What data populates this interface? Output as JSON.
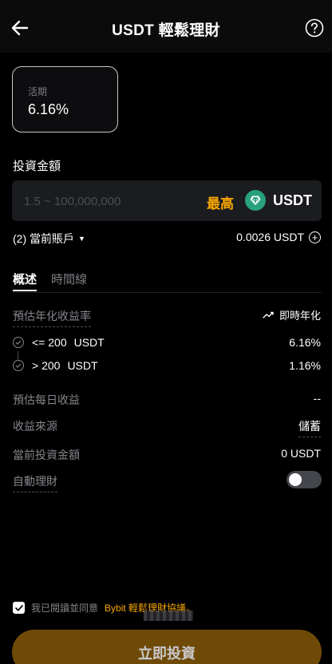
{
  "header": {
    "title": "USDT 輕鬆理財",
    "back_icon": "arrow-left-icon",
    "help_icon": "question-circle-icon"
  },
  "plan_card": {
    "label": "活期",
    "rate": "6.16%"
  },
  "amount": {
    "section_label": "投資金額",
    "placeholder": "1.5 ~ 100,000,000",
    "value": "",
    "max_label": "最高",
    "currency": "USDT",
    "currency_icon": "tether-icon"
  },
  "account": {
    "label": "(2) 當前賬戶",
    "balance": "0.0026 USDT"
  },
  "tabs": [
    {
      "label": "概述",
      "active": true
    },
    {
      "label": "時間線",
      "active": false
    }
  ],
  "overview": {
    "apr_label": "預估年化收益率",
    "realtime_label": "即時年化",
    "tiers": [
      {
        "range": "<= 200",
        "unit": "USDT",
        "rate": "6.16%"
      },
      {
        "range": "> 200",
        "unit": "USDT",
        "rate": "1.16%"
      }
    ],
    "daily_label": "預估每日收益",
    "daily_value": "--",
    "source_label": "收益來源",
    "source_value": "儲蓄",
    "current_label": "當前投資金額",
    "current_value": "0 USDT",
    "auto_label": "自動理財",
    "auto_enabled": false
  },
  "agreement": {
    "checked": true,
    "text": "我已閱讀並同意",
    "link": "Bybit 輕鬆理財協議。"
  },
  "submit": {
    "label": "立即投資"
  },
  "colors": {
    "accent": "#f7a600",
    "button_bg": "#6f4a07",
    "usdt_green": "#28a17c"
  }
}
